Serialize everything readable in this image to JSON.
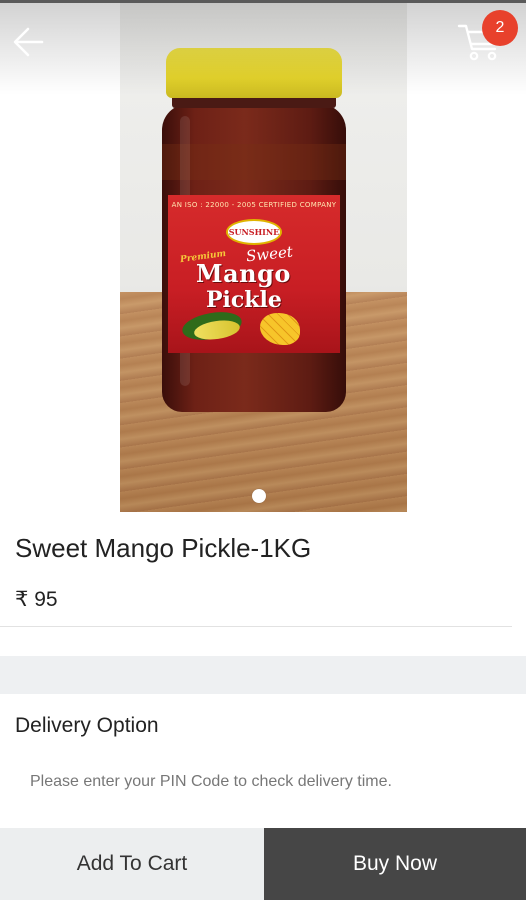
{
  "header": {
    "back_icon": "arrow-left-icon",
    "cart_icon": "shopping-cart-icon",
    "cart_count": "2",
    "badge_color": "#e8412c"
  },
  "gallery": {
    "current_index": 1,
    "total_images": 1,
    "label_text": {
      "certification": "AN ISO : 22000 - 2005 CERTIFIED COMPANY",
      "brand": "SUNSHINE",
      "tagline_premium": "Premium",
      "tagline_sweet": "Sweet",
      "product_word_1": "Mango",
      "product_word_2": "Pickle"
    }
  },
  "product": {
    "title": "Sweet Mango Pickle-1KG",
    "price": "₹ 95"
  },
  "delivery": {
    "heading": "Delivery Option",
    "hint": "Please enter your PIN Code to check delivery time."
  },
  "actions": {
    "add_to_cart_label": "Add To Cart",
    "buy_now_label": "Buy Now",
    "buy_now_color": "#464646",
    "add_to_cart_color": "#eceeef"
  }
}
